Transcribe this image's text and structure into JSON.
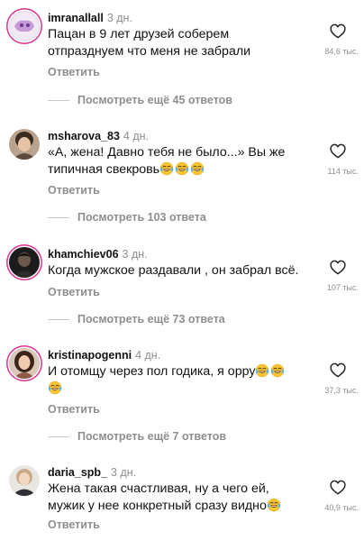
{
  "reply_label": "Ответить",
  "comments": [
    {
      "username": "imranallall",
      "time": "3 дн.",
      "text": "Пацан в 9 лет друзей соберем\nотпразднуем что меня не забрали",
      "likes": "84,6 тыс.",
      "view_more": "Посмотреть ещё 45 ответов"
    },
    {
      "username": "msharova_83",
      "time": "4 дн.",
      "text": "«А, жена! Давно тебя не было...» Вы же\nтипичная свекровь",
      "likes": "114 тыс.",
      "view_more": "Посмотреть 103 ответа"
    },
    {
      "username": "khamchiev06",
      "time": "3 дн.",
      "text": "Когда мужское раздавали , он забрал всё.",
      "likes": "107 тыс.",
      "view_more": "Посмотреть ещё 73 ответа"
    },
    {
      "username": "kristinapogenni",
      "time": "4 дн.",
      "text": "И отомщу через пол годика, я орру",
      "likes": "37,3 тыс.",
      "view_more": "Посмотреть ещё 7 ответов"
    },
    {
      "username": "daria_spb_",
      "time": "3 дн.",
      "text": "Жена такая счастливая, ну а чего ей,\nмужик у нее конкретный сразу видно",
      "likes": "40,9 тыс."
    }
  ],
  "icons": {
    "like": "heart-outline-icon",
    "emoji": "face-with-tears-of-joy-emoji"
  },
  "colors": {
    "text": "#111111",
    "secondary": "#8e8e8e",
    "story_ring": "#d7338f"
  }
}
